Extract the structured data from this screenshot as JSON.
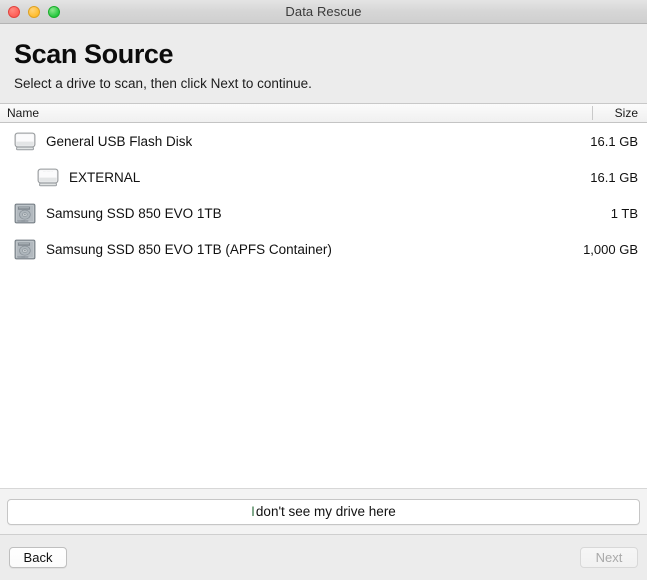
{
  "window": {
    "title": "Data Rescue",
    "traffic_lights": [
      "close-button",
      "minimize-button",
      "maximize-button"
    ]
  },
  "hero": {
    "title": "Scan Source",
    "subtitle": "Select a drive to scan, then click Next to continue."
  },
  "table": {
    "columns": {
      "name": "Name",
      "size": "Size"
    },
    "rows": [
      {
        "name": "General USB Flash Disk",
        "size": "16.1 GB",
        "icon": "external-drive-icon",
        "indent": 0
      },
      {
        "name": "EXTERNAL",
        "size": "16.1 GB",
        "icon": "external-volume-icon",
        "indent": 1
      },
      {
        "name": "Samsung SSD 850 EVO 1TB",
        "size": "1 TB",
        "icon": "internal-disk-icon",
        "indent": 0
      },
      {
        "name": "Samsung SSD 850 EVO 1TB (APFS Container)",
        "size": "1,000 GB",
        "icon": "internal-disk-icon",
        "indent": 0
      }
    ]
  },
  "prefooter": {
    "drive_help_lead": "I",
    "drive_help_rest": " don't see my drive here"
  },
  "footer": {
    "back_label": "Back",
    "next_label": "Next"
  },
  "colors": {
    "accent_green": "#3c7a4a",
    "window_chrome": "#ececec",
    "table_background": "#ffffff"
  }
}
